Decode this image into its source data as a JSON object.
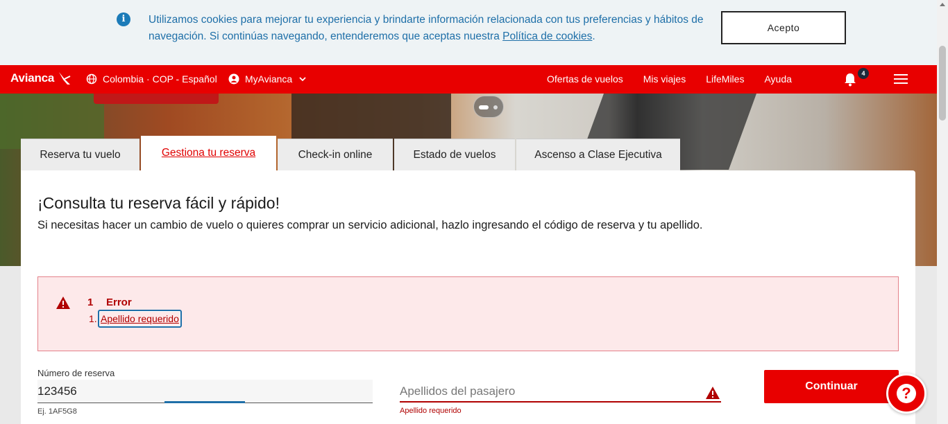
{
  "cookie": {
    "text_main": "Utilizamos cookies para mejorar tu experiencia y brindarte información relacionada con tus preferencias y hábitos de navegación. Si continúas navegando, entenderemos que aceptas nuestra ",
    "link": "Política de cookies",
    "text_end": ".",
    "accept_label": "Acepto"
  },
  "header": {
    "logo": "Avianca",
    "locale": "Colombia · COP - Español",
    "account": "MyAvianca",
    "nav": [
      "Ofertas de vuelos",
      "Mis viajes",
      "LifeMiles",
      "Ayuda"
    ],
    "notifications_count": "4"
  },
  "tabs": [
    {
      "label": "Reserva tu vuelo",
      "active": false
    },
    {
      "label": "Gestiona tu reserva",
      "active": true
    },
    {
      "label": "Check-in online",
      "active": false
    },
    {
      "label": "Estado de vuelos",
      "active": false
    },
    {
      "label": "Ascenso a Clase Ejecutiva",
      "active": false
    }
  ],
  "card": {
    "title": "¡Consulta tu reserva fácil y rápido!",
    "subtitle": "Si necesitas hacer un cambio de vuelo o quieres comprar un servicio adicional, hazlo ingresando el código de reserva y tu apellido."
  },
  "error_summary": {
    "count": "1",
    "label": "Error",
    "items": [
      {
        "num": "1.",
        "text": "Apellido requerido"
      }
    ]
  },
  "form": {
    "reservation_label": "Número de reserva",
    "reservation_value": "123456",
    "reservation_hint": "Ej. 1AF5G8",
    "lastname_placeholder": "Apellidos del pasajero",
    "lastname_error": "Apellido requerido",
    "continue_label": "Continuar"
  },
  "colors": {
    "brand": "#e80000",
    "error": "#b00000",
    "link": "#1e6fa8"
  }
}
